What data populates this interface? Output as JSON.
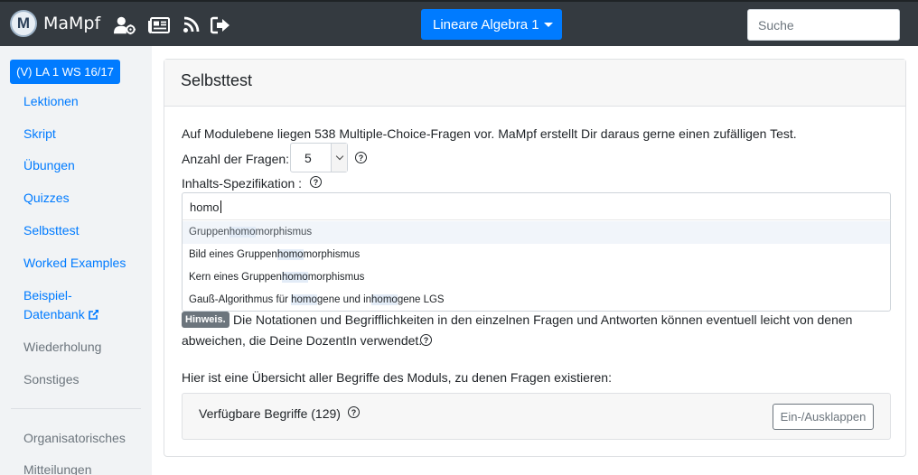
{
  "navbar": {
    "brand": "MaMpf",
    "brand_logo_letter": "M",
    "course_button": "Lineare Algebra 1",
    "search_placeholder": "Suche",
    "icons": [
      "user-cog-icon",
      "newspaper-icon",
      "rss-icon",
      "sign-out-icon"
    ]
  },
  "sidebar": {
    "lecture": "(V) LA 1 WS 16/17",
    "items": [
      {
        "label": "Lektionen"
      },
      {
        "label": "Skript"
      },
      {
        "label": "Übungen"
      },
      {
        "label": "Quizzes"
      },
      {
        "label": "Selbsttest"
      },
      {
        "label": "Worked Examples"
      },
      {
        "label": "Beispiel-"
      },
      {
        "label": "Datenbank"
      },
      {
        "label": "Wiederholung"
      },
      {
        "label": "Sonstiges"
      },
      {
        "label": "Organisatorisches"
      },
      {
        "label": "Mitteilungen"
      }
    ]
  },
  "main": {
    "title": "Selbsttest",
    "intro": "Auf Modulebene liegen 538 Multiple-Choice-Fragen vor. MaMpf erstellt Dir daraus gerne einen zufälligen Test.",
    "count_label": "Anzahl der Fragen:",
    "count_value": "5",
    "spec_label": "Inhalts-Spezifikation :",
    "spec_input": "homo",
    "suggestions": [
      {
        "pre": "Gruppen",
        "hl": "homo",
        "post": "morphismus"
      },
      {
        "pre": "Bild eines Gruppen",
        "hl": "homo",
        "post": "morphismus"
      },
      {
        "pre": "Kern eines Gruppen",
        "hl": "homo",
        "post": "morphismus"
      },
      {
        "pre": "Gauß-Algorithmus für ",
        "hl": "homo",
        "mid": "gene und in",
        "hl2": "homo",
        "post": "gene LGS"
      }
    ],
    "hint_badge": "Hinweis.",
    "hint_line1": "Die Notationen und Begrifflichkeiten in den einzelnen Fragen und Antworten können eventuell leicht von denen",
    "hint_line2": "abweichen, die Deine DozentIn verwendet.",
    "overview": "Hier ist eine Übersicht aller Begriffe des Moduls, zu denen Fragen existieren:",
    "available_terms": "Verfügbare Begriffe (129)",
    "toggle_button": "Ein-/Ausklappen",
    "help_glyph": "?"
  }
}
